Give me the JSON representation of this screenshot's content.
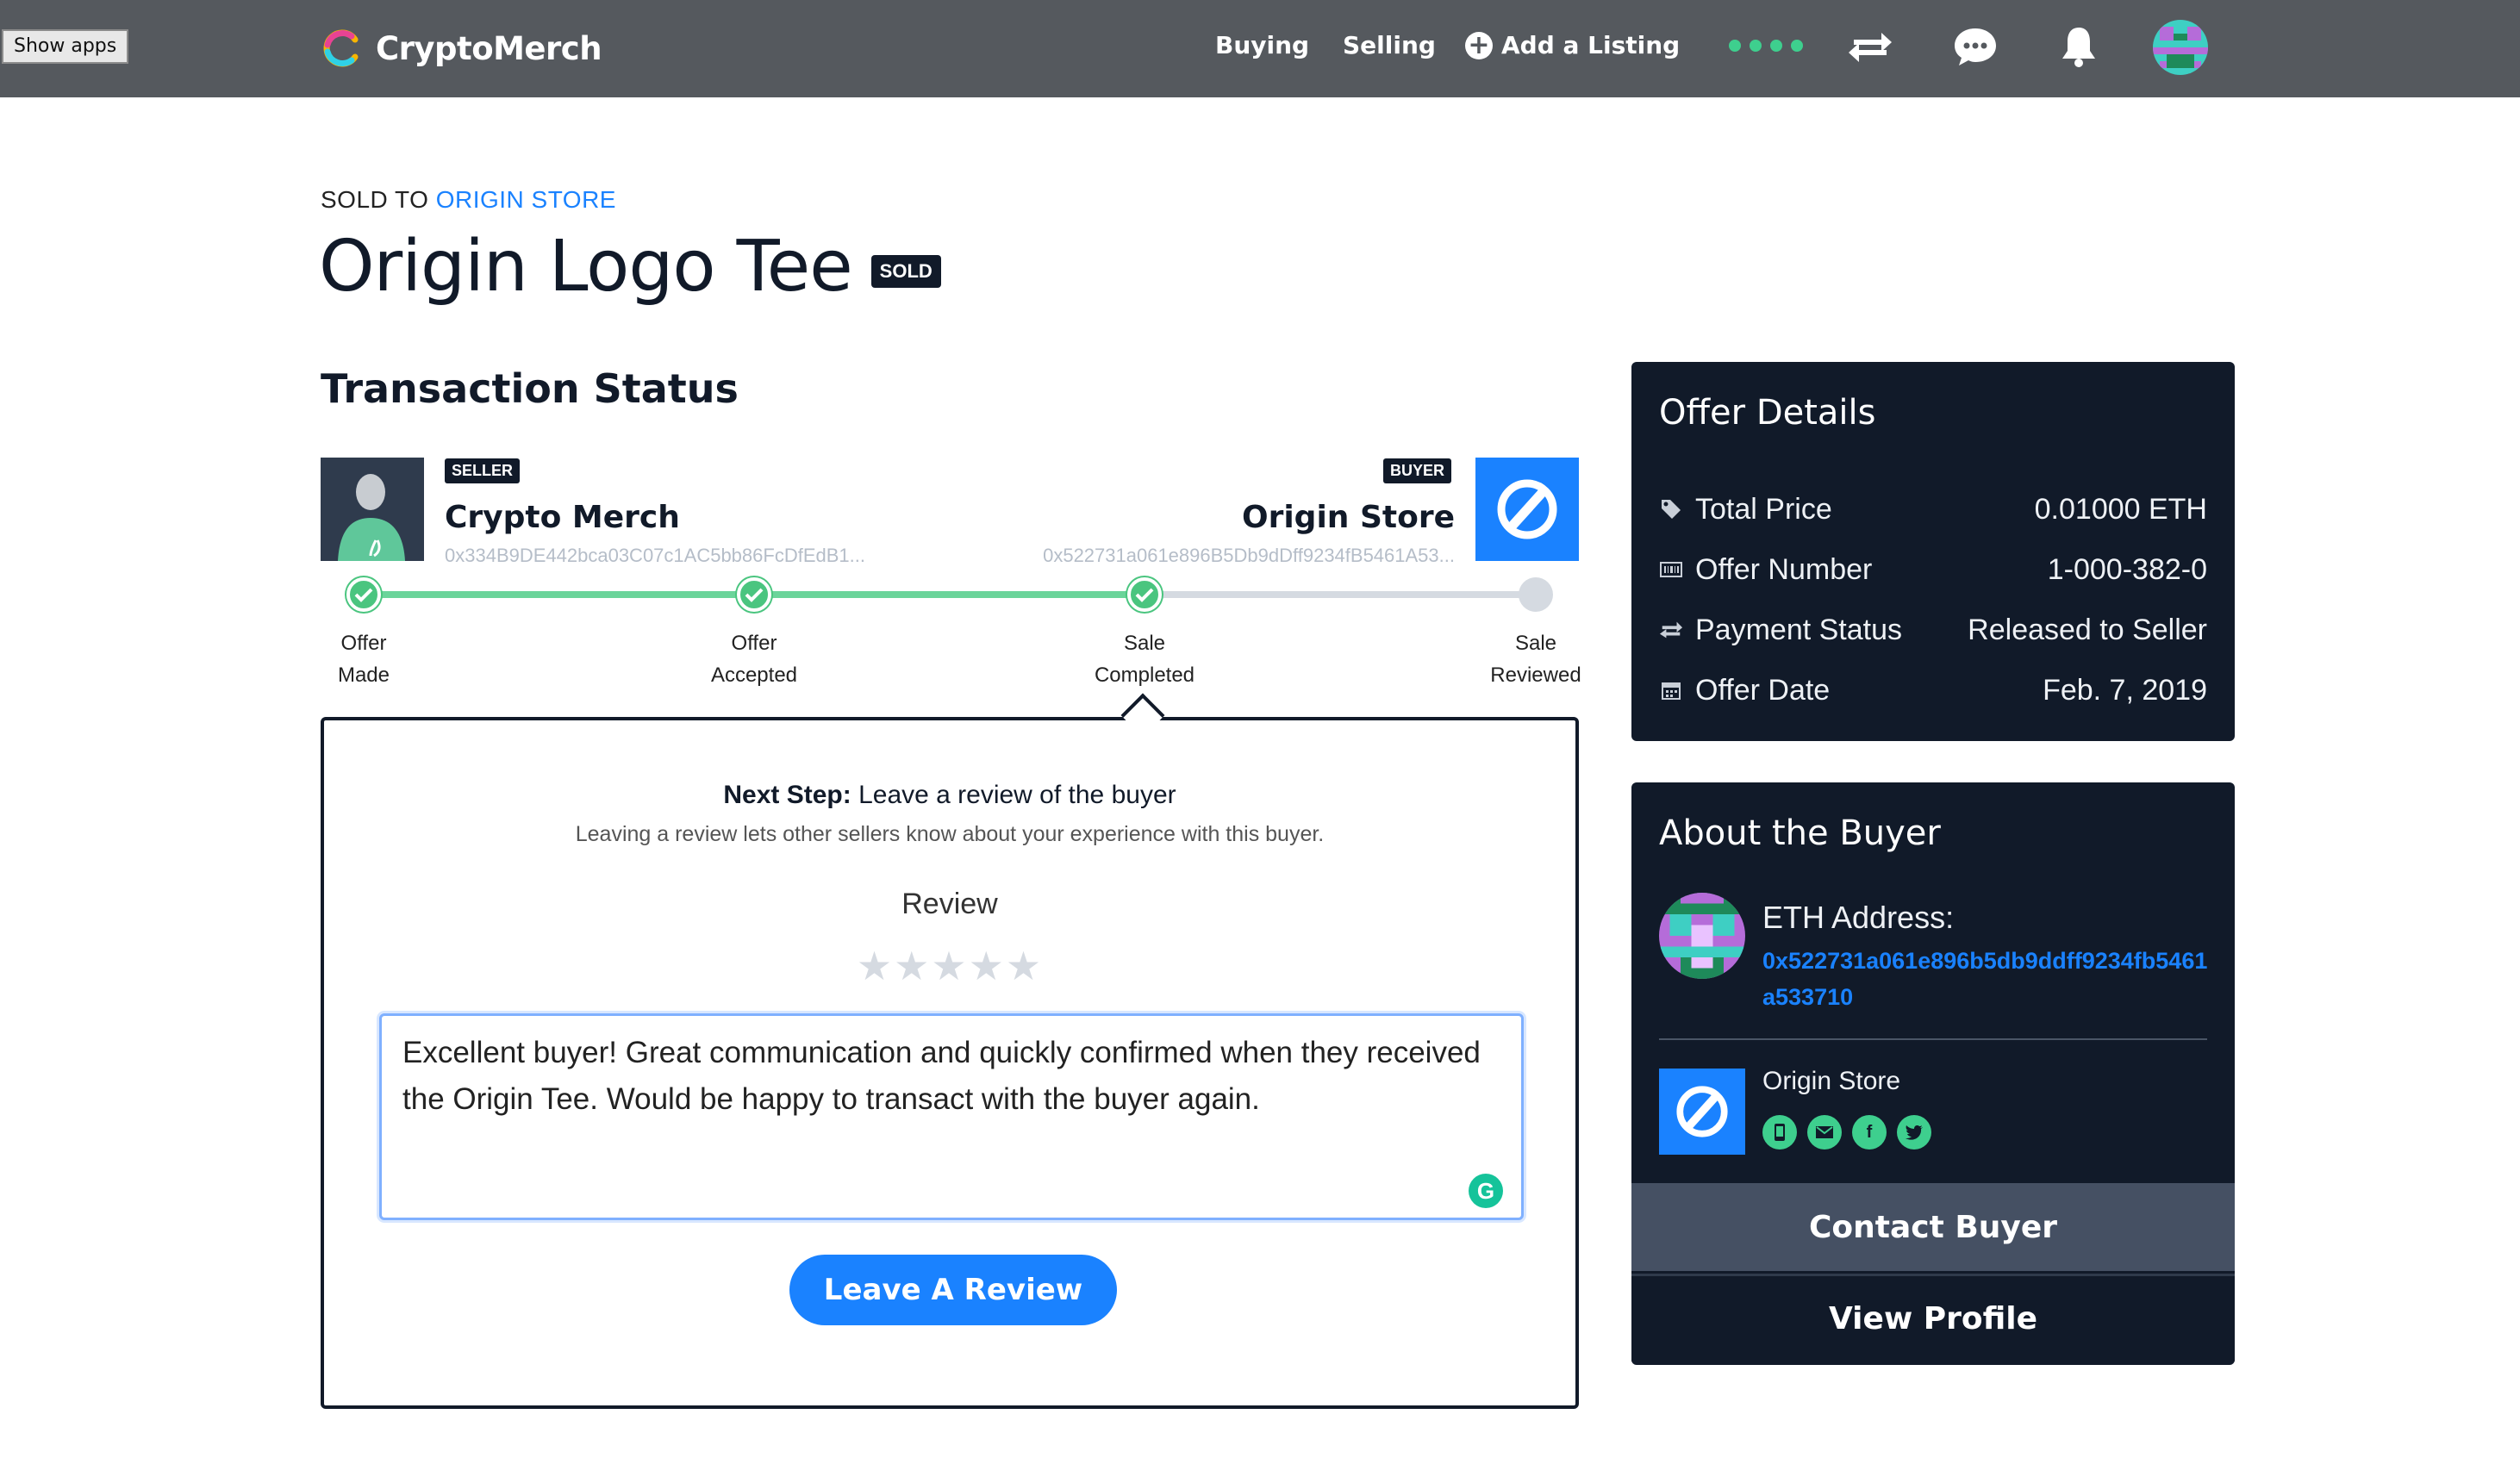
{
  "browser": {
    "show_apps": "Show apps"
  },
  "nav": {
    "brand": "CryptoMerch",
    "buying": "Buying",
    "selling": "Selling",
    "add_listing": "Add a Listing",
    "icons": [
      "transfer-icon",
      "chat-icon",
      "bell-icon",
      "avatar-icon"
    ]
  },
  "listing": {
    "sold_to_prefix": "SOLD TO",
    "sold_to_name": "ORIGIN STORE",
    "title": "Origin Logo Tee",
    "status_badge": "SOLD"
  },
  "transaction": {
    "title": "Transaction Status",
    "seller": {
      "badge": "SELLER",
      "name": "Crypto Merch",
      "address": "0x334B9DE442bca03C07c1AC5bb86FcDfEdB1..."
    },
    "buyer": {
      "badge": "BUYER",
      "name": "Origin Store",
      "address": "0x522731a061e896B5Db9dDff9234fB5461A53..."
    },
    "steps": [
      {
        "line1": "Offer",
        "line2": "Made",
        "done": true
      },
      {
        "line1": "Offer",
        "line2": "Accepted",
        "done": true
      },
      {
        "line1": "Sale",
        "line2": "Completed",
        "done": true
      },
      {
        "line1": "Sale",
        "line2": "Reviewed",
        "done": false
      }
    ]
  },
  "review": {
    "next_step_bold": "Next Step:",
    "next_step_text": " Leave a review of the buyer",
    "subtitle": "Leaving a review lets other sellers know about your experience with this buyer.",
    "label": "Review",
    "stars": "★★★★★",
    "rating": 0,
    "text": "Excellent buyer! Great communication and quickly confirmed when they received the Origin Tee. Would be happy to transact with the buyer again.",
    "grammarly": "G",
    "submit": "Leave A Review"
  },
  "offer_details": {
    "title": "Offer Details",
    "rows": [
      {
        "label": "Total Price",
        "value": "0.01000 ETH",
        "icon": "tag-icon"
      },
      {
        "label": "Offer Number",
        "value": "1-000-382-0",
        "icon": "barcode-icon"
      },
      {
        "label": "Payment Status",
        "value": "Released to Seller",
        "icon": "transfer-icon"
      },
      {
        "label": "Offer Date",
        "value": "Feb. 7, 2019",
        "icon": "calendar-icon"
      }
    ]
  },
  "about_buyer": {
    "title": "About the Buyer",
    "eth_label": "ETH Address:",
    "eth_address": "0x522731a061e896b5db9ddff9234fb5461a533710",
    "store_name": "Origin Store",
    "verifications": [
      "phone-icon",
      "email-icon",
      "facebook-icon",
      "twitter-icon"
    ],
    "contact_button": "Contact Buyer",
    "profile_button": "View Profile"
  },
  "colors": {
    "accent": "#1a82ff",
    "success": "#4ac57f",
    "dark": "#111a29",
    "nav": "#55595e"
  }
}
